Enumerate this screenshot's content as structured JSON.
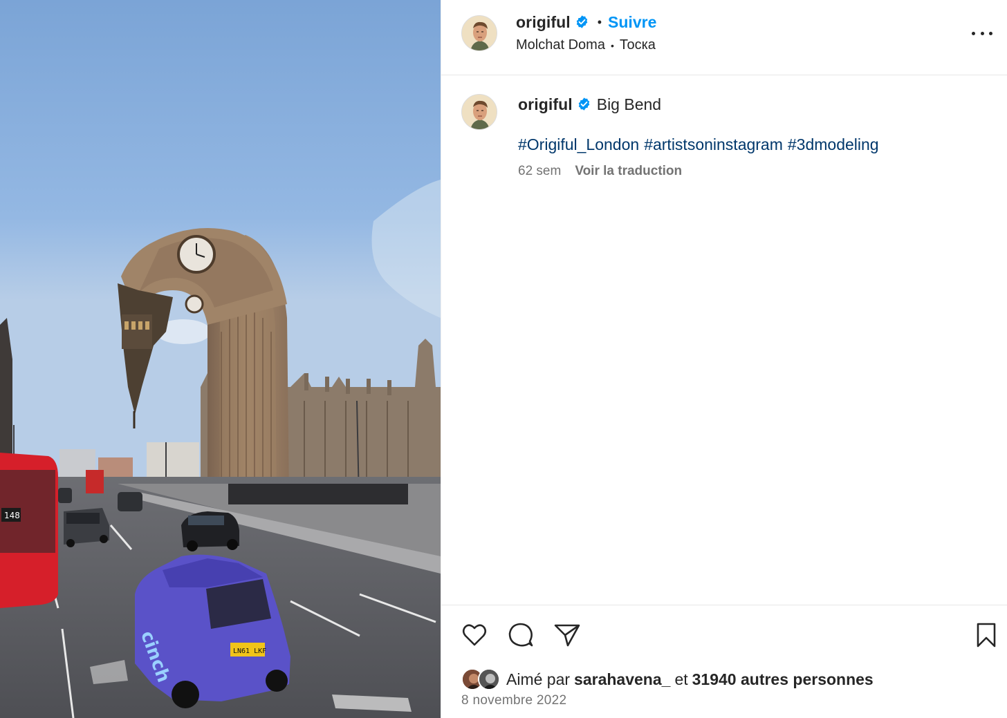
{
  "post": {
    "author": "origiful",
    "verified": true,
    "follow_label": "Suivre",
    "audio_artist": "Molchat Doma",
    "audio_track": "Тоска",
    "more_icon": "more-horizontal-icon"
  },
  "caption": {
    "author": "origiful",
    "text": "Big Bend",
    "hashtags": [
      "#Origiful_London",
      "#artistsoninstagram",
      "#3dmodeling"
    ],
    "age": "62 sem",
    "translate_label": "Voir la traduction"
  },
  "actions": {
    "like_icon": "heart-icon",
    "comment_icon": "comment-icon",
    "share_icon": "send-icon",
    "save_icon": "bookmark-icon"
  },
  "likes": {
    "prefix": "Aimé par",
    "user": "sarahavena_",
    "joiner": "et",
    "others": "31940 autres personnes"
  },
  "date": "8 novembre 2022",
  "media": {
    "bus_number": "148",
    "plate": "LN61 LKF",
    "taxi_ad": "cinch"
  },
  "colors": {
    "accent": "#0095f6",
    "hashtag": "#00376b",
    "secondary_text": "#737373",
    "verified": "#0095f6"
  }
}
